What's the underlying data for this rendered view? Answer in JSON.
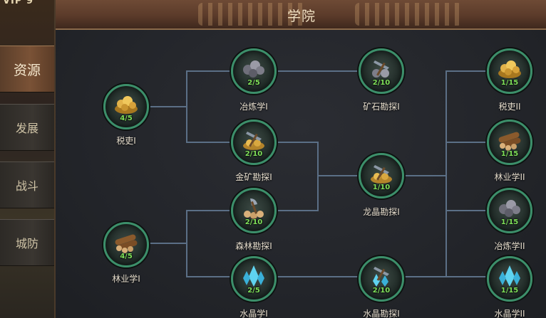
{
  "top": {
    "vip_text": "VIP 9"
  },
  "header": {
    "title": "学院"
  },
  "tabs": [
    {
      "label": "资源",
      "active": true
    },
    {
      "label": "发展",
      "active": false
    },
    {
      "label": "战斗",
      "active": false
    },
    {
      "label": "城防",
      "active": false
    }
  ],
  "techs": [
    {
      "name": "税吏I",
      "level": "4/5",
      "icon": "gold-pile-icon"
    },
    {
      "name": "林业学I",
      "level": "4/5",
      "icon": "logs-icon"
    },
    {
      "name": "冶炼学I",
      "level": "2/5",
      "icon": "ore-pile-icon"
    },
    {
      "name": "金矿勘探I",
      "level": "2/10",
      "icon": "pickaxe-gold-icon"
    },
    {
      "name": "森林勘探I",
      "level": "2/10",
      "icon": "axe-logs-icon"
    },
    {
      "name": "水晶学I",
      "level": "2/5",
      "icon": "crystal-icon"
    },
    {
      "name": "矿石勘探I",
      "level": "2/10",
      "icon": "pickaxe-ore-icon"
    },
    {
      "name": "龙晶勘探I",
      "level": "1/10",
      "icon": "pickaxe-gold-icon"
    },
    {
      "name": "水晶勘探I",
      "level": "2/10",
      "icon": "pickaxe-crystal-icon"
    },
    {
      "name": "税吏II",
      "level": "1/15",
      "icon": "gold-pile-icon"
    },
    {
      "name": "林业学II",
      "level": "1/15",
      "icon": "logs-icon"
    },
    {
      "name": "冶炼学II",
      "level": "1/15",
      "icon": "ore-pile-icon"
    },
    {
      "name": "水晶学II",
      "level": "1/15",
      "icon": "crystal-icon"
    }
  ],
  "colors": {
    "level_text": "#7fe05a",
    "node_ring": "#3c8f6a",
    "connector": "#5b6f86"
  }
}
